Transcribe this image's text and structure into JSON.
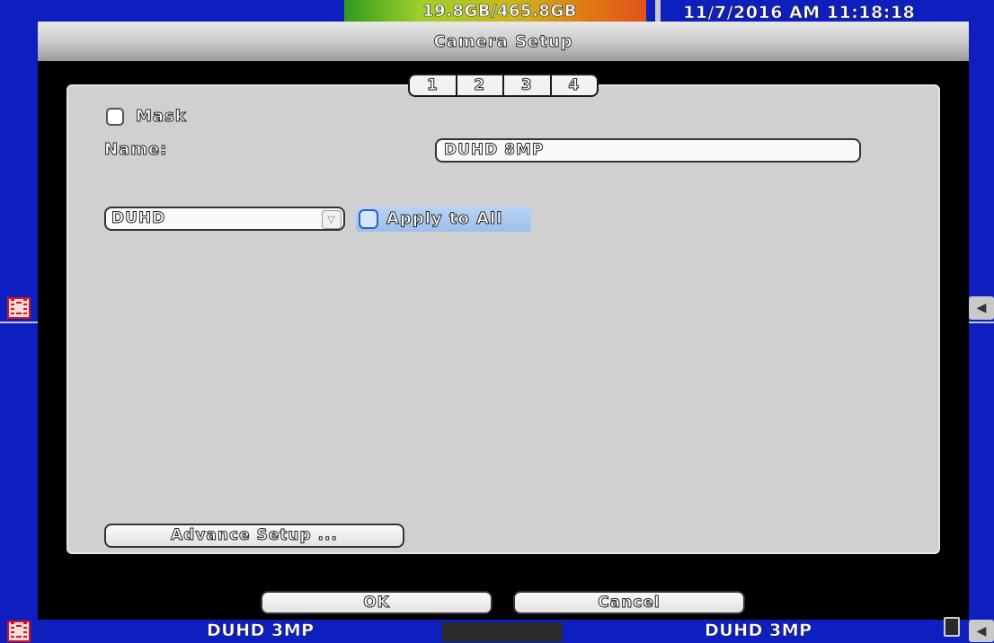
{
  "status_bar": {
    "storage_text": "19.8GB/465.8GB",
    "storage_used_fraction": 0.97,
    "datetime": "11/7/2016 AM 11:18:18"
  },
  "dialog": {
    "title": "Camera Setup",
    "tabs": [
      "1",
      "2",
      "3",
      "4"
    ],
    "mask": {
      "label": "Mask",
      "checked": false
    },
    "name": {
      "label": "Name:",
      "value": "DUHD 8MP"
    },
    "type_select": {
      "value": "DUHD"
    },
    "apply_all": {
      "label": "Apply to All",
      "checked": false
    },
    "advance_button": "Advance Setup ...",
    "ok_button": "OK",
    "cancel_button": "Cancel"
  },
  "bottom_bar": {
    "left_label": "DUHD 3MP",
    "right_label": "DUHD 3MP"
  },
  "icons": {
    "channel": "film-icon",
    "audio": "speaker-icon",
    "storage": "hdd-icon"
  },
  "colors": {
    "background": "#0f1fbf",
    "dialog": "#000000",
    "panel": "#d0d0d0",
    "accent_icon": "#e01212"
  }
}
